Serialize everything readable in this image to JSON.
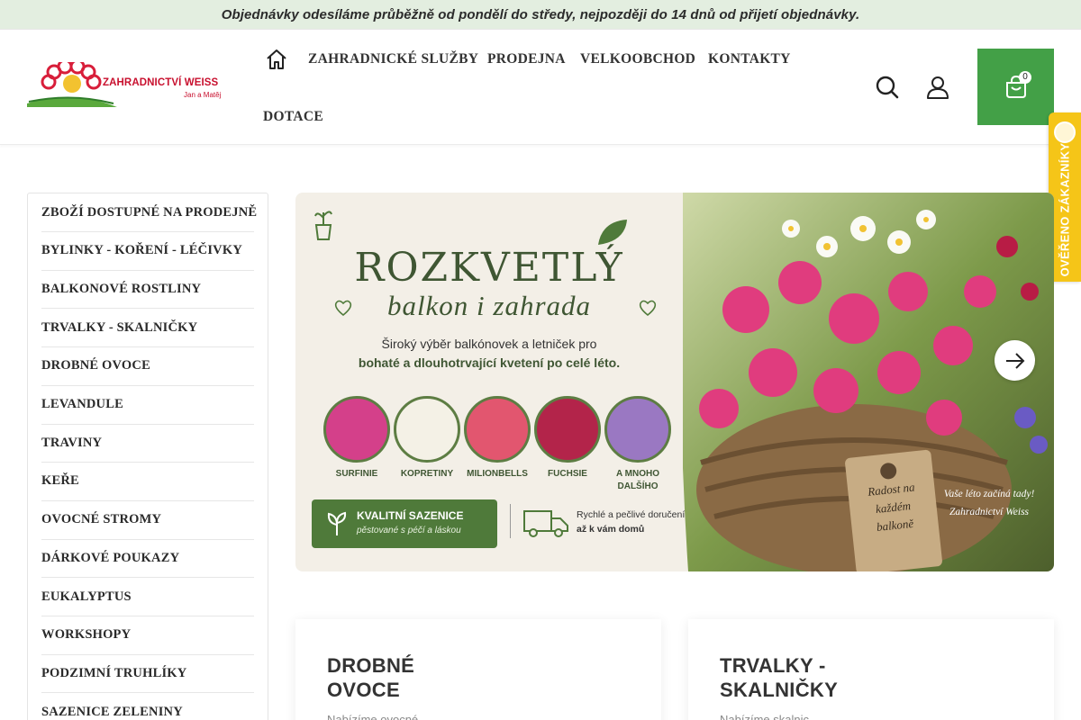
{
  "announcement": "Objednávky odesíláme průběžně od pondělí do středy, nejpozději do 14 dnů od přijetí objednávky.",
  "logo": {
    "name": "ZAHRADNICTVÍ WEISS",
    "tagline": "Jan a Matěj"
  },
  "nav": {
    "items": [
      "ZAHRADNICKÉ SLUŽBY",
      "PRODEJNA",
      "VELKOOBCHOD",
      "KONTAKTY",
      "DOTACE"
    ]
  },
  "cart": {
    "count": "0"
  },
  "verified_badge": "OVĚŘENO ZÁKAZNÍKY",
  "sidebar": {
    "items": [
      "ZBOŽÍ DOSTUPNÉ NA PRODEJNĚ",
      "BYLINKY - KOŘENÍ - LÉČIVKY",
      "BALKONOVÉ ROSTLINY",
      "TRVALKY - SKALNIČKY",
      "DROBNÉ OVOCE",
      "LEVANDULE",
      "TRAVINY",
      "KEŘE",
      "OVOCNÉ STROMY",
      "DÁRKOVÉ POUKAZY",
      "EUKALYPTUS",
      "WORKSHOPY",
      "PODZIMNÍ TRUHLÍKY",
      "SAZENICE ZELENINY"
    ]
  },
  "banner": {
    "title": "ROZKVETLÝ",
    "subtitle": "balkon i zahrada",
    "line1": "Široký výběr balkónovek a letniček pro",
    "line2": "bohaté a dlouhotrvající kvetení po celé léto.",
    "flowers": [
      {
        "label": "SURFINIE",
        "color": "#d4408a"
      },
      {
        "label": "KOPRETINY",
        "color": "#f4f1e6"
      },
      {
        "label": "MILIONBELLS",
        "color": "#e2566f"
      },
      {
        "label": "FUCHSIE",
        "color": "#b3244a"
      },
      {
        "label": "A MNOHO\nDALŠÍHO",
        "color": "#9a78c2"
      }
    ],
    "quality_title": "KVALITNÍ SAZENICE",
    "quality_sub": "pěstované s péčí a láskou",
    "delivery_line1": "Rychlé a pečlivé doručení",
    "delivery_line2": "až k vám domů",
    "tag_text": "Radost na každém balkoně",
    "promo_text": "Vaše léto začíná tady! Zahradnictví Weiss"
  },
  "cards": [
    {
      "title": "DROBNÉ OVOCE",
      "desc": "Nabízíme ovocné..."
    },
    {
      "title": "TRVALKY - SKALNIČKY",
      "desc": "Nabízíme skalnic..."
    }
  ],
  "colors": {
    "accent_green": "#43a047",
    "announcement_bg": "#e3eee0",
    "badge_yellow": "#f5c518",
    "brand_red": "#c8102e"
  }
}
